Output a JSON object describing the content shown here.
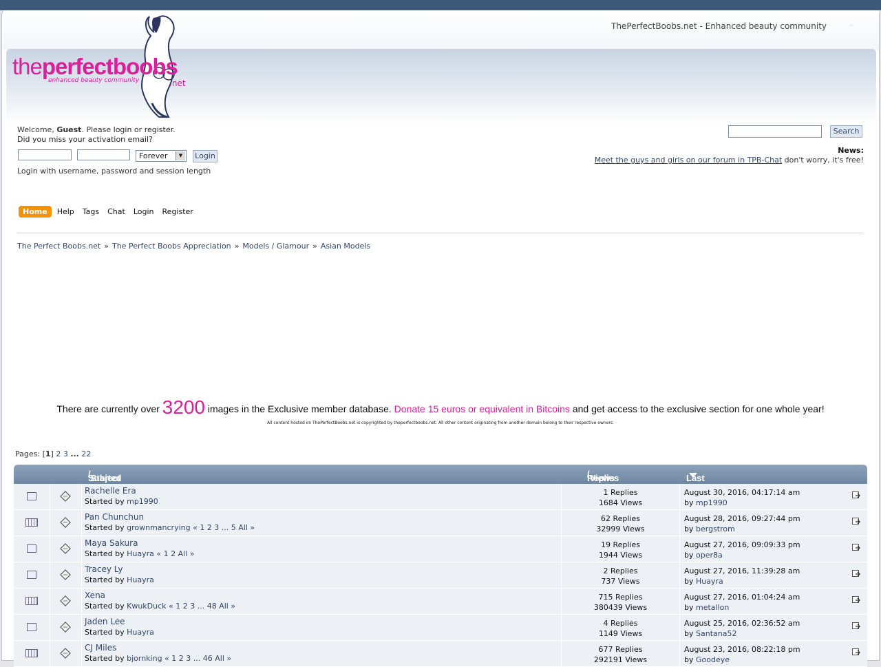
{
  "site": {
    "tagline": "ThePerfectBoobs.net - Enhanced beauty community",
    "logo_main_light": "the",
    "logo_main_bold": "perfect",
    "logo_main_tail": "boobs",
    "logo_sub": "enhanced beauty community",
    "logo_net": ".net",
    "brand_color": "#dd1e9a"
  },
  "user": {
    "welcome_prefix": "Welcome, ",
    "guest": "Guest",
    "welcome_suffix": ". Please ",
    "login_link": "login",
    "or": " or ",
    "register_link": "register",
    "period": ".",
    "activation": "Did you miss your activation email?",
    "session_option": "Forever",
    "login_button": "Login",
    "login_hint": "Login with username, password and session length"
  },
  "search": {
    "button": "Search"
  },
  "news": {
    "label": "News:",
    "link": "Meet the guys and girls on our forum in TPB-Chat",
    "tail": " don't worry, it's free!"
  },
  "menu": [
    "Home",
    "Help",
    "Tags",
    "Chat",
    "Login",
    "Register"
  ],
  "breadcrumb": [
    "The Perfect Boobs.net",
    "The Perfect Boobs Appreciation",
    "Models / Glamour",
    "Asian Models"
  ],
  "promo": {
    "pre": "There are currently over ",
    "count": "3200",
    "mid": " images in the Exclusive member database. ",
    "donate": "Donate 15 euros or equivalent in Bitcoins",
    "post": " and get access to the exclusive section for one whole year!",
    "copyright": "All content hosted on ThePerfectBoobs.net is copyrighted by theperfectboobs.net. All other content originating from another domain belong to their respective owners."
  },
  "pagination": {
    "label": "Pages: ",
    "current": "1",
    "p2": "2",
    "p3": "3",
    "ellipsis": "...",
    "last": "22"
  },
  "table": {
    "col_subject": "Subject",
    "col_started": "Started by",
    "col_replies": "Replies",
    "col_views": "Views",
    "col_last": "Last post",
    "rows": [
      {
        "title": "Rachelle Era",
        "started_prefix": "Started by ",
        "author": "mp1990",
        "pages": "",
        "replies": "1 Replies",
        "views": "1684 Views",
        "date": "August 30, 2016, 04:17:14 am",
        "by_prefix": "by ",
        "by": "mp1990",
        "hot": false
      },
      {
        "title": "Pan Chunchun",
        "started_prefix": "Started by ",
        "author": "grownmancrying",
        "pages": "« 1 2 3 ... 5  All »",
        "replies": "62 Replies",
        "views": "32999 Views",
        "date": "August 28, 2016, 09:27:44 pm",
        "by_prefix": "by ",
        "by": "bergstrom",
        "hot": true
      },
      {
        "title": "Maya Sakura",
        "started_prefix": "Started by ",
        "author": "Huayra",
        "pages": "« 1 2  All »",
        "replies": "19 Replies",
        "views": "1944 Views",
        "date": "August 27, 2016, 09:09:33 pm",
        "by_prefix": "by ",
        "by": "oper8a",
        "hot": false
      },
      {
        "title": "Tracey Ly",
        "started_prefix": "Started by ",
        "author": "Huayra",
        "pages": "",
        "replies": "2 Replies",
        "views": "737 Views",
        "date": "August 27, 2016, 11:39:28 am",
        "by_prefix": "by ",
        "by": "Huayra",
        "hot": false
      },
      {
        "title": "Xena",
        "started_prefix": "Started by ",
        "author": "KwukDuck",
        "pages": "« 1 2 3 ... 48  All »",
        "replies": "715 Replies",
        "views": "380439 Views",
        "date": "August 27, 2016, 01:04:24 am",
        "by_prefix": "by ",
        "by": "metallon",
        "hot": true
      },
      {
        "title": "Jaden Lee",
        "started_prefix": "Started by ",
        "author": "Huayra",
        "pages": "",
        "replies": "4 Replies",
        "views": "1149 Views",
        "date": "August 25, 2016, 02:36:52 am",
        "by_prefix": "by ",
        "by": "Santana52",
        "hot": false
      },
      {
        "title": "CJ Miles",
        "started_prefix": "Started by ",
        "author": "bjornking",
        "pages": "« 1 2 3 ... 46  All »",
        "replies": "677 Replies",
        "views": "292191 Views",
        "date": "August 23, 2016, 08:22:18 pm",
        "by_prefix": "by ",
        "by": "Goodeye",
        "hot": true
      }
    ]
  }
}
